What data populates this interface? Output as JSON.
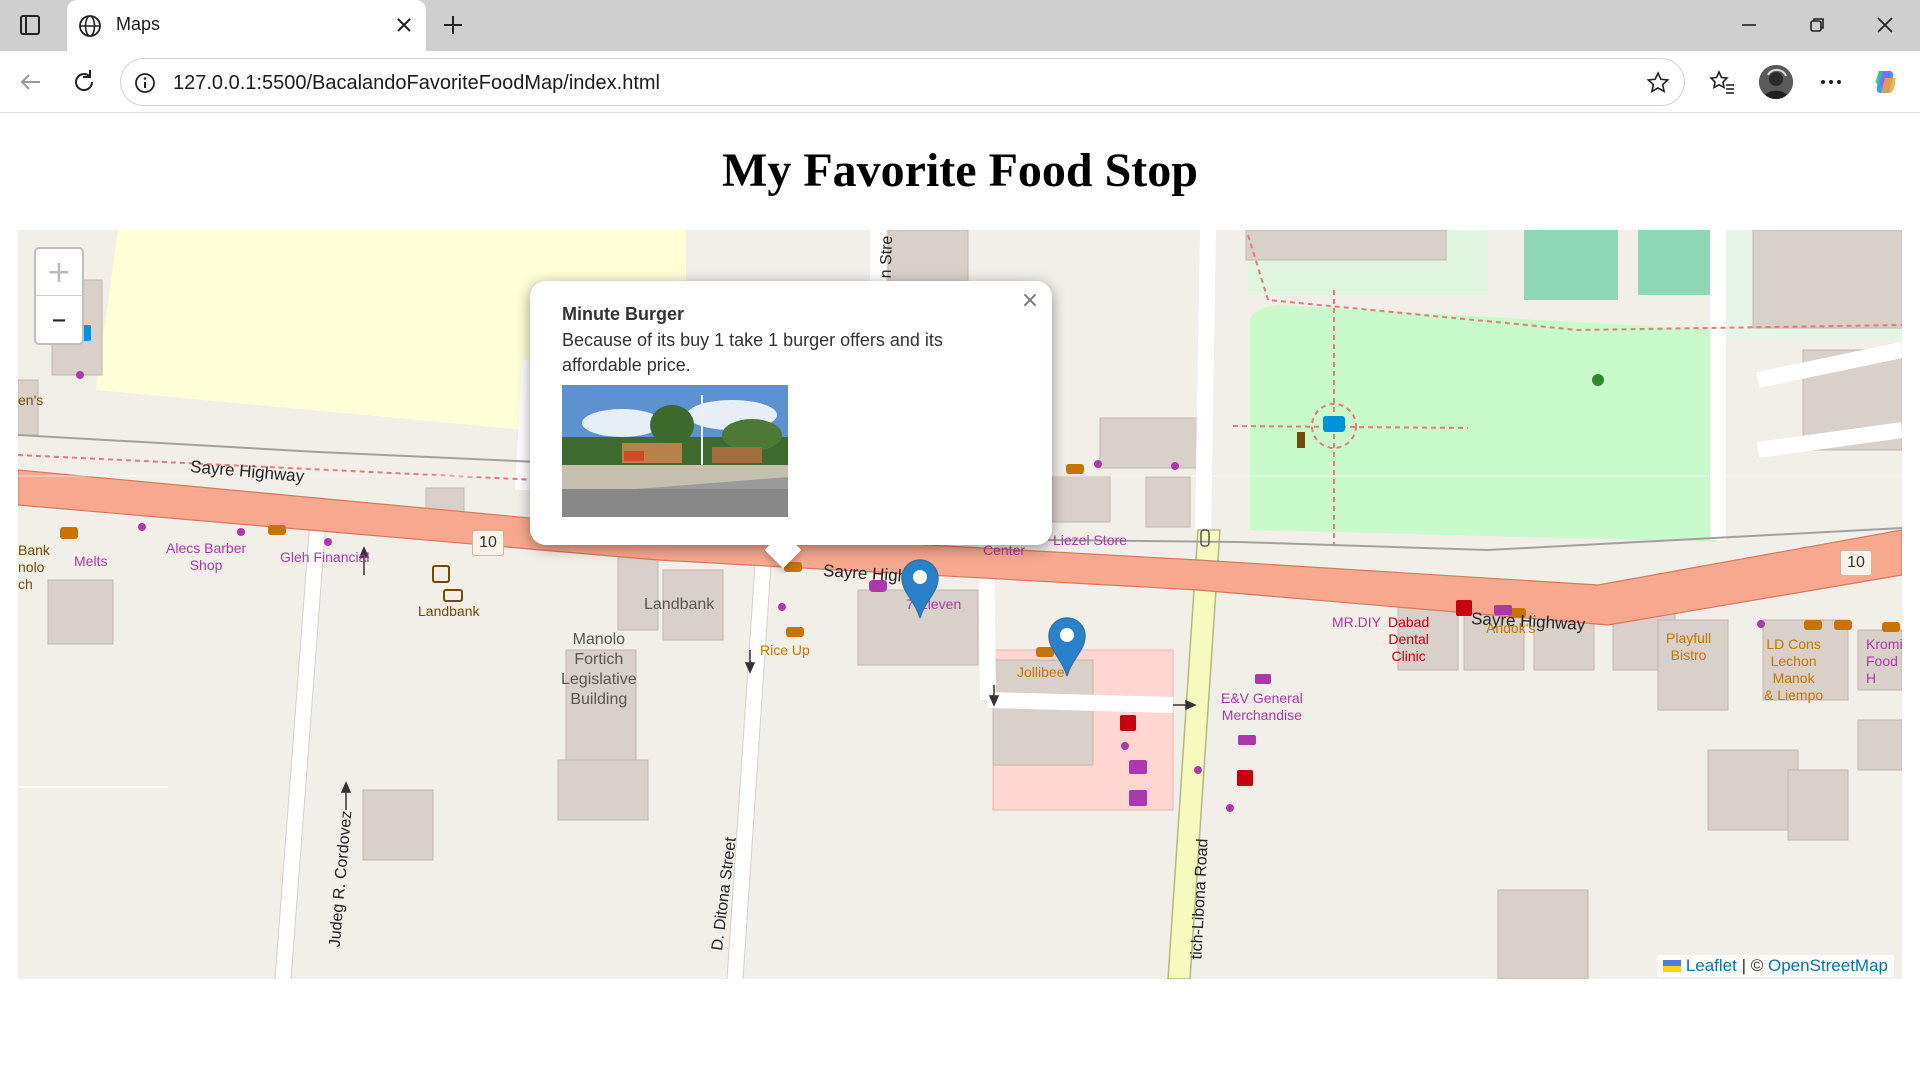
{
  "browser": {
    "tab_title": "Maps",
    "url": "127.0.0.1:5500/BacalandoFavoriteFoodMap/index.html"
  },
  "page": {
    "title": "My Favorite Food Stop"
  },
  "map": {
    "zoom_in": "+",
    "zoom_out": "–",
    "road_labels": {
      "sayre1": "Sayre Highway",
      "sayre2": "Sayre Highway",
      "sayre3": "Sayre Highway",
      "ditona": "D. Ditona Street",
      "cordovez": "Judeg R. Cordovez",
      "libona": "tich-Libona Road",
      "stre": "n Stre"
    },
    "shield_10": "10",
    "poi_labels": {
      "liezel": "Liezel Store",
      "center": "Center",
      "melts": "Melts",
      "alecs": "Alecs Barber\nShop",
      "gleh": "Gleh Financial",
      "landbank1": "Landbank",
      "landbank2": "Landbank",
      "manolo": "Manolo\nFortich\nLegislative\nBuilding",
      "riceup": "Rice Up",
      "seveneleven": "7-Eleven",
      "jollibee": "Jollibee",
      "mrdiy": "MR.DIY",
      "dabad": "Dabad\nDental\nClinic",
      "andoks": "Andok's",
      "ev": "E&V General\nMerchandise",
      "playfull": "Playfull\nBistro",
      "ldcons": "LD Cons\nLechon\nManok\n& Liempo",
      "kromi": "Kromi\nFood H",
      "bank_left": "Bank\nnolo\nch",
      "ens": "en's"
    },
    "popup": {
      "title": "Minute Burger",
      "description": "Because of its buy 1 take 1 burger offers and its affordable price.",
      "close": "×"
    },
    "attribution": {
      "leaflet": "Leaflet",
      "separator": " | © ",
      "osm": "OpenStreetMap"
    }
  },
  "colors": {
    "highway": "#f7a88e",
    "park": "#c8facc",
    "marker": "#2a81cb",
    "poi_purple": "#ac39ac",
    "poi_food": "#c77400",
    "link": "#0078a8"
  }
}
